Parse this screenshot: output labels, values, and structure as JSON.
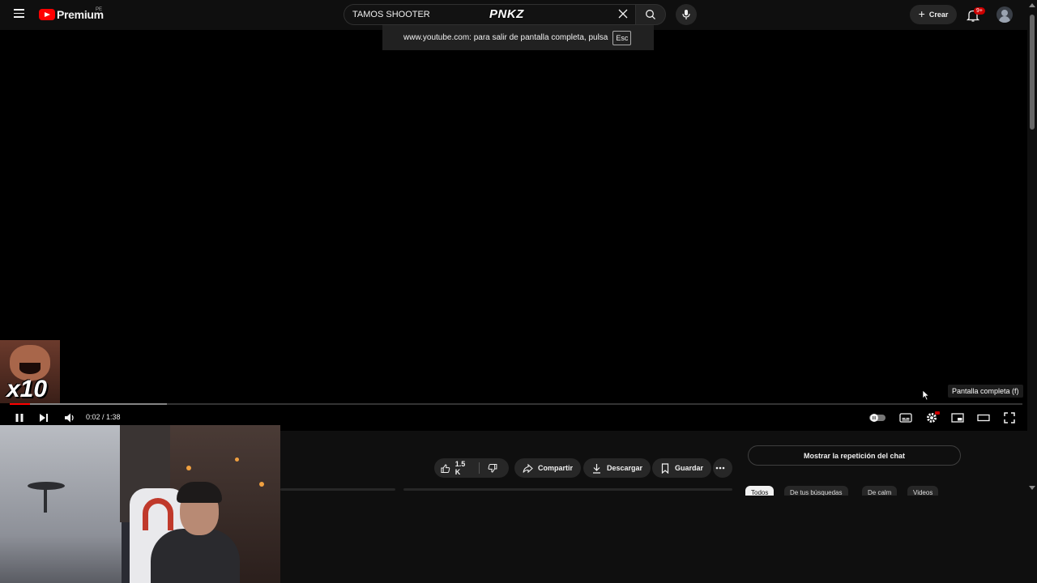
{
  "header": {
    "logo_text": "Premium",
    "logo_region": "PE",
    "search_value": "TAMOS SHOOTER",
    "brand_overlay": "PNKZ",
    "create_label": "Crear",
    "notifications_badge": "9+"
  },
  "fullscreen_notice": {
    "text": "www.youtube.com: para salir de pantalla completa, pulsa",
    "key": "Esc"
  },
  "player": {
    "time_display": "0:02 / 1:38",
    "played_fraction": 0.02,
    "buffered_fraction": 0.155,
    "tooltip": "Pantalla completa (f)",
    "progress_color": "#ff0000"
  },
  "overlay": {
    "multiplier": "x10"
  },
  "actions": {
    "like_count": "1.5 K",
    "share_label": "Compartir",
    "download_label": "Descargar",
    "save_label": "Guardar"
  },
  "chat": {
    "replay_label": "Mostrar la repetición del chat"
  },
  "chips": [
    "Todos",
    "De tus búsquedas",
    "De calm",
    "Videos"
  ]
}
